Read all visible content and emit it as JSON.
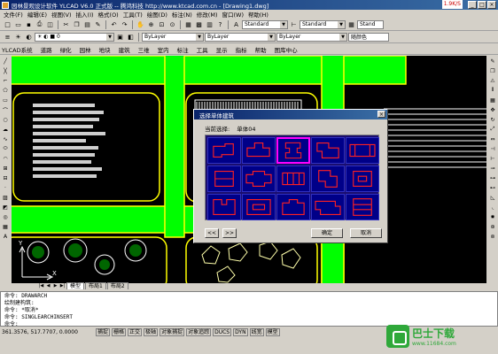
{
  "titlebar": {
    "title": "园林景观设计软件 YLCAD V6.0 正式版 -- 腾鸿科技 http://www.ktcad.com.cn - [Drawing1.dwg]",
    "speed": "1.9K/S"
  },
  "menu": [
    "文件(F)",
    "编辑(E)",
    "视图(V)",
    "插入(I)",
    "格式(O)",
    "工具(T)",
    "绘图(D)",
    "标注(N)",
    "修改(M)",
    "窗口(W)",
    "帮助(H)"
  ],
  "toolbar2": {
    "layer": "ByLayer",
    "style": "Standard",
    "linetype": "ByLayer",
    "lineweight": "ByLayer",
    "color": "随颜色"
  },
  "toolbar1": {
    "style1": "Standard",
    "style2": "Standard",
    "style3": "Stand"
  },
  "custmenu": [
    "YLCAD系统",
    "道路",
    "绿化",
    "园林",
    "地块",
    "建筑",
    "三维",
    "室内",
    "标注",
    "工具",
    "显示",
    "指标",
    "帮助",
    "图库中心"
  ],
  "tabs": [
    "模型",
    "布局1",
    "布局2"
  ],
  "command": [
    "命令: DRAWARCH",
    "绘制建构筑:",
    "命令: *取消*",
    "命令: SINGLEARCHINSERT",
    "命令:"
  ],
  "status": {
    "coords": "361.3576, 517.7707, 0.0000",
    "toggles": [
      "捕捉",
      "栅格",
      "正交",
      "极轴",
      "对象捕捉",
      "对象追踪",
      "DUCS",
      "DYN",
      "线宽",
      "模型"
    ]
  },
  "dialog": {
    "title": "选择单体建筑",
    "current_label": "当前选择:",
    "current_value": "单体04",
    "prev": "<<",
    "next": ">>",
    "ok": "确定",
    "cancel": "取消"
  },
  "watermark": {
    "brand": "巴士下载",
    "url": "www.11684.com"
  },
  "colors": {
    "road": "#00ff00",
    "road_edge": "#ffff00",
    "canvas": "#000000",
    "dialog_grid": "#000088",
    "building_outline": "#ff0000"
  }
}
